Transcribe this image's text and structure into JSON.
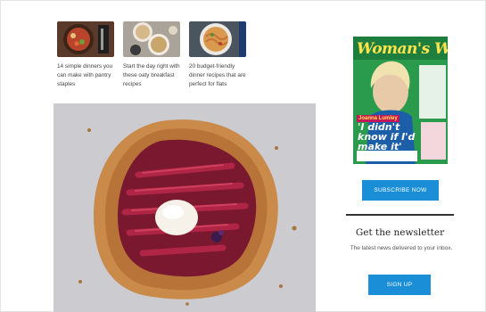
{
  "articles": [
    {
      "title": "14 simple dinners you can make with pantry staples"
    },
    {
      "title": "Start the day right with these oaty breakfast recipes"
    },
    {
      "title": "20 budget-friendly dinner recipes that are perfect for flats"
    }
  ],
  "hero": {
    "icon": "rhubarb-galette-photo"
  },
  "magazine": {
    "title": "Woman's Weekly",
    "strap": "Joanna Lumley",
    "headline": "'I didn't know if I'd make it'",
    "cover_colors": {
      "background": "#2a9b4d",
      "title": "#ffe44d"
    }
  },
  "subscribe": {
    "label": "Subscribe Now"
  },
  "newsletter": {
    "title": "Get the newsletter",
    "description": "The latest news delivered to your inbox.",
    "signup_label": "Sign up"
  },
  "colors": {
    "accent": "#1a8fd8"
  }
}
